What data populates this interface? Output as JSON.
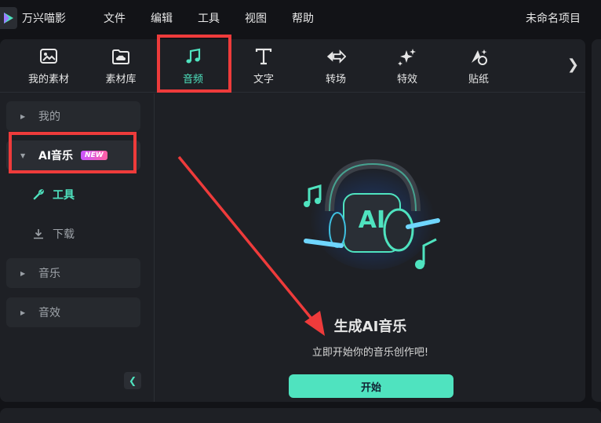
{
  "app": {
    "name": "万兴喵影",
    "project": "未命名项目"
  },
  "menu": [
    "文件",
    "编辑",
    "工具",
    "视图",
    "帮助"
  ],
  "toolbar": {
    "tabs": [
      {
        "label": "我的素材",
        "icon": "image-icon"
      },
      {
        "label": "素材库",
        "icon": "cloud-folder-icon"
      },
      {
        "label": "音频",
        "icon": "music-note-icon",
        "active": true
      },
      {
        "label": "文字",
        "icon": "text-icon"
      },
      {
        "label": "转场",
        "icon": "transition-icon"
      },
      {
        "label": "特效",
        "icon": "sparkle-icon"
      },
      {
        "label": "贴纸",
        "icon": "sticker-icon"
      }
    ],
    "more_icon": "chevron-right-icon"
  },
  "sidebar": {
    "items": [
      {
        "label": "我的"
      },
      {
        "label": "AI音乐",
        "badge": "NEW",
        "expanded": true
      },
      {
        "label": "工具",
        "icon": "wrench-icon",
        "active": true
      },
      {
        "label": "下载",
        "icon": "download-icon"
      },
      {
        "label": "音乐"
      },
      {
        "label": "音效"
      }
    ],
    "collapse_icon": "chevron-left-icon"
  },
  "main": {
    "title": "生成AI音乐",
    "subtitle": "立即开始你的音乐创作吧!",
    "start_label": "开始",
    "hero_text": "AI"
  },
  "colors": {
    "accent": "#4fe3bf",
    "annotation": "#ee3b3b",
    "panel": "#1e2025",
    "background": "#121317"
  }
}
